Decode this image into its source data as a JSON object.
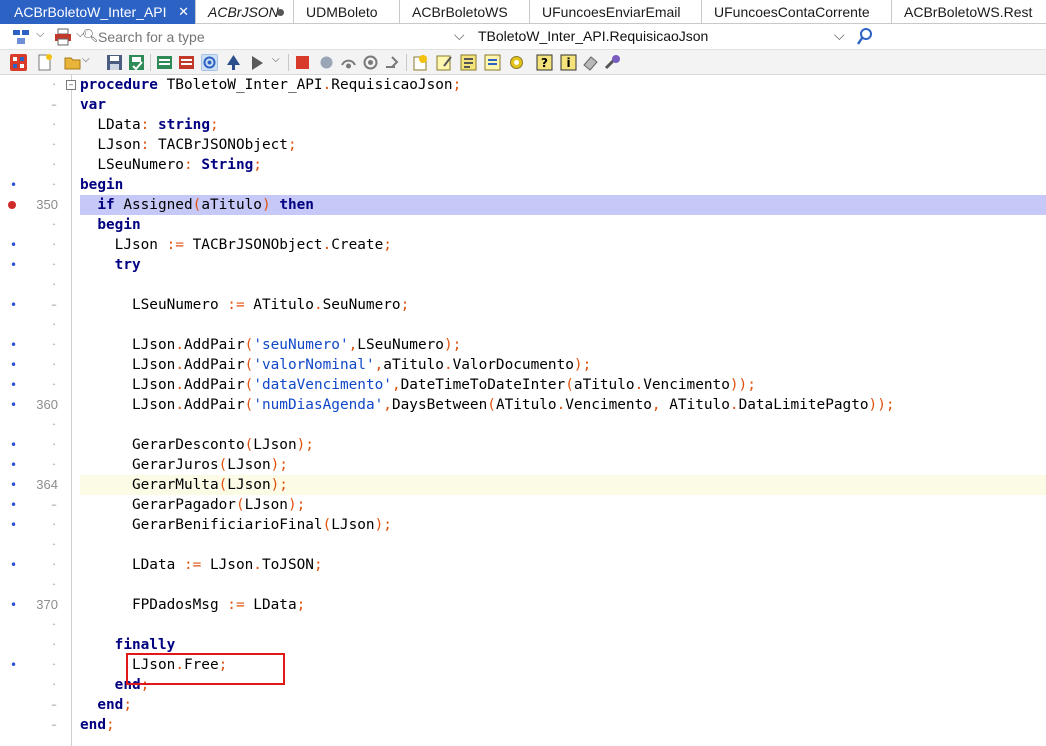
{
  "tabs": [
    {
      "label": "ACBrBoletoW_Inter_API",
      "close": "✕",
      "active": true
    },
    {
      "label": "ACBrJSON",
      "italic": true,
      "modified": true
    },
    {
      "label": "UDMBoleto"
    },
    {
      "label": "ACBrBoletoWS"
    },
    {
      "label": "UFuncoesEnviarEmail"
    },
    {
      "label": "UFuncoesContaCorrente"
    },
    {
      "label": "ACBrBoletoWS.Rest"
    }
  ],
  "search": {
    "placeholder": "Search for a type"
  },
  "unit_selector": {
    "value": "TBoletoW_Inter_API.RequisicaoJson"
  },
  "editor": {
    "lines": [
      {
        "gutter": "·",
        "fold": "⊟",
        "html": "<span class=\"kw\">procedure</span> TBoletoW_Inter_API<span class=\"op\">.</span>RequisicaoJson<span class=\"op\">;</span>"
      },
      {
        "gutter": "–",
        "html": "<span class=\"kw\">var</span>"
      },
      {
        "gutter": "·",
        "html": "  LData<span class=\"op\">:</span> <span class=\"kw\">string</span><span class=\"op\">;</span>"
      },
      {
        "gutter": "·",
        "html": "  LJson<span class=\"op\">:</span> TACBrJSONObject<span class=\"op\">;</span>"
      },
      {
        "gutter": "·",
        "html": "  LSeuNumero<span class=\"op\">:</span> <span class=\"kw\">String</span><span class=\"op\">;</span>"
      },
      {
        "gutter": "·",
        "mark": true,
        "html": "<span class=\"kw\">begin</span>"
      },
      {
        "num": "350",
        "bp": true,
        "exec": true,
        "html": "  <span class=\"kw\">if</span> Assigned<span class=\"op\">(</span>aTitulo<span class=\"op\">)</span> <span class=\"kw\">then</span>"
      },
      {
        "gutter": "·",
        "html": "  <span class=\"kw\">begin</span>"
      },
      {
        "gutter": "·",
        "mark": true,
        "html": "    LJson <span class=\"op\">:=</span> TACBrJSONObject<span class=\"op\">.</span>Create<span class=\"op\">;</span>"
      },
      {
        "gutter": "·",
        "mark": true,
        "html": "    <span class=\"kw\">try</span>"
      },
      {
        "gutter": "·",
        "html": ""
      },
      {
        "gutter": "–",
        "mark": true,
        "html": "      LSeuNumero <span class=\"op\">:=</span> ATitulo<span class=\"op\">.</span>SeuNumero<span class=\"op\">;</span>"
      },
      {
        "gutter": "·",
        "html": ""
      },
      {
        "gutter": "·",
        "mark": true,
        "html": "      LJson<span class=\"op\">.</span>AddPair<span class=\"op\">(</span><span class=\"str\">'seuNumero'</span><span class=\"op\">,</span>LSeuNumero<span class=\"op\">);</span>"
      },
      {
        "gutter": "·",
        "mark": true,
        "html": "      LJson<span class=\"op\">.</span>AddPair<span class=\"op\">(</span><span class=\"str\">'valorNominal'</span><span class=\"op\">,</span>aTitulo<span class=\"op\">.</span>ValorDocumento<span class=\"op\">);</span>"
      },
      {
        "gutter": "·",
        "mark": true,
        "html": "      LJson<span class=\"op\">.</span>AddPair<span class=\"op\">(</span><span class=\"str\">'dataVencimento'</span><span class=\"op\">,</span>DateTimeToDateInter<span class=\"op\">(</span>aTitulo<span class=\"op\">.</span>Vencimento<span class=\"op\">));</span>"
      },
      {
        "num": "360",
        "mark": true,
        "html": "      LJson<span class=\"op\">.</span>AddPair<span class=\"op\">(</span><span class=\"str\">'numDiasAgenda'</span><span class=\"op\">,</span>DaysBetween<span class=\"op\">(</span>ATitulo<span class=\"op\">.</span>Vencimento<span class=\"op\">,</span> ATitulo<span class=\"op\">.</span>DataLimitePagto<span class=\"op\">));</span>"
      },
      {
        "gutter": "·",
        "html": ""
      },
      {
        "gutter": "·",
        "mark": true,
        "html": "      GerarDesconto<span class=\"op\">(</span>LJson<span class=\"op\">);</span>"
      },
      {
        "gutter": "·",
        "mark": true,
        "html": "      GerarJuros<span class=\"op\">(</span>LJson<span class=\"op\">);</span>"
      },
      {
        "num": "364",
        "mark": true,
        "current": true,
        "html": "      GerarMulta<span class=\"op\">(</span>LJson<span class=\"op\">);</span>"
      },
      {
        "gutter": "–",
        "mark": true,
        "html": "      GerarPagador<span class=\"op\">(</span>LJson<span class=\"op\">);</span>"
      },
      {
        "gutter": "·",
        "mark": true,
        "html": "      GerarBenificiarioFinal<span class=\"op\">(</span>LJson<span class=\"op\">);</span>"
      },
      {
        "gutter": "·",
        "html": ""
      },
      {
        "gutter": "·",
        "mark": true,
        "html": "      LData <span class=\"op\">:=</span> LJson<span class=\"op\">.</span>ToJSON<span class=\"op\">;</span>"
      },
      {
        "gutter": "·",
        "html": ""
      },
      {
        "num": "370",
        "mark": true,
        "html": "      FPDadosMsg <span class=\"op\">:=</span> LData<span class=\"op\">;</span>"
      },
      {
        "gutter": "·",
        "html": ""
      },
      {
        "gutter": "·",
        "html": "    <span class=\"kw\">finally</span>"
      },
      {
        "gutter": "·",
        "mark": true,
        "html": "      LJson<span class=\"op\">.</span>Free<span class=\"op\">;</span>"
      },
      {
        "gutter": "·",
        "html": "    <span class=\"kw\">end</span><span class=\"op\">;</span>"
      },
      {
        "gutter": "–",
        "html": "  <span class=\"kw\">end</span><span class=\"op\">;</span>"
      },
      {
        "gutter": "–",
        "html": "<span class=\"kw\">end</span><span class=\"op\">;</span>"
      }
    ]
  },
  "icons": {
    "toolbar": [
      "structure-icon",
      "new-file-icon",
      "open-folder-icon",
      "save-icon",
      "save-all-icon",
      "project-icon",
      "build-icon",
      "debug-icon",
      "run-icon",
      "pause-icon",
      "stop-icon",
      "step-over-icon",
      "trace-into-icon",
      "run-to-cursor-icon",
      "breakpoint-icon",
      "evaluate-icon",
      "watch-icon",
      "options-icon",
      "help-icon",
      "info-icon",
      "eraser-icon",
      "tools-icon"
    ]
  }
}
